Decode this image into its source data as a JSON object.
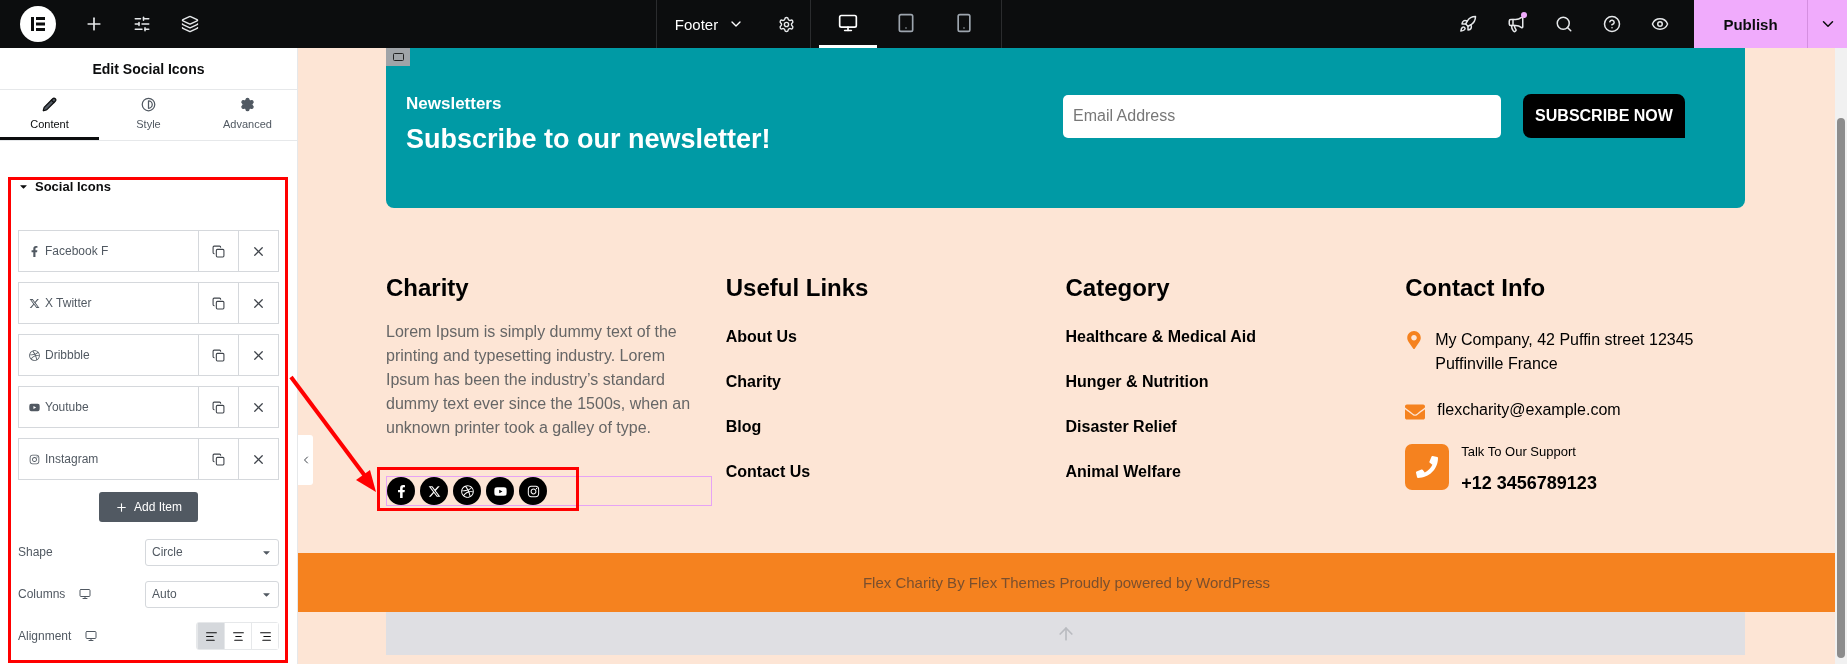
{
  "topbar": {
    "document": "Footer",
    "devices": [
      {
        "kind": "desktop",
        "selected": true
      },
      {
        "kind": "tablet",
        "selected": false
      },
      {
        "kind": "mobile",
        "selected": false
      }
    ],
    "publish": "Publish"
  },
  "panel": {
    "title": "Edit Social Icons",
    "tabs": [
      {
        "label": "Content",
        "kind": "content",
        "selected": true
      },
      {
        "label": "Style",
        "kind": "style",
        "selected": false
      },
      {
        "label": "Advanced",
        "kind": "advanced",
        "selected": false
      }
    ],
    "section": {
      "title": "Social Icons",
      "expanded": true
    },
    "items": [
      {
        "label": "Facebook F",
        "kind": "facebook"
      },
      {
        "label": "X Twitter",
        "kind": "x"
      },
      {
        "label": "Dribbble",
        "kind": "dribbble"
      },
      {
        "label": "Youtube",
        "kind": "youtube"
      },
      {
        "label": "Instagram",
        "kind": "instagram"
      }
    ],
    "add_button": "Add Item",
    "controls": [
      {
        "label": "Shape",
        "kind": "select",
        "value": "Circle",
        "responsive": false
      },
      {
        "label": "Columns",
        "kind": "select",
        "value": "Auto",
        "responsive": true
      },
      {
        "label": "Alignment",
        "kind": "align",
        "responsive": true,
        "options": [
          {
            "kind": "left",
            "selected": true
          },
          {
            "kind": "center",
            "selected": false
          },
          {
            "kind": "right",
            "selected": false
          }
        ]
      }
    ]
  },
  "canvas": {
    "newsletter": {
      "eyebrow": "Newsletters",
      "title": "Subscribe to our newsletter!",
      "placeholder": "Email Address",
      "button": "SUBSCRIBE NOW"
    },
    "about": {
      "title": "Charity",
      "text": "Lorem Ipsum is simply dummy text of the printing and typesetting industry. Lorem Ipsum has been the industry’s standard dummy text ever since the 1500s, when an unknown printer took a galley of type.",
      "social": [
        {
          "kind": "facebook"
        },
        {
          "kind": "x"
        },
        {
          "kind": "dribbble"
        },
        {
          "kind": "youtube"
        },
        {
          "kind": "instagram"
        }
      ]
    },
    "link_columns": [
      {
        "title": "Useful Links",
        "items": [
          "About Us",
          "Charity",
          "Blog",
          "Contact Us"
        ]
      },
      {
        "title": "Category",
        "items": [
          "Healthcare & Medical Aid",
          "Hunger & Nutrition",
          "Disaster Relief",
          "Animal Welfare"
        ]
      }
    ],
    "contact": {
      "title": "Contact Info",
      "address": "My Company, 42 Puffin street 12345 Puffinville France",
      "email": "flexcharity@example.com",
      "support_label": "Talk To Our Support",
      "phone": "+12 3456789123"
    },
    "copyright": "Flex Charity By Flex Themes Proudly powered by WordPress"
  }
}
